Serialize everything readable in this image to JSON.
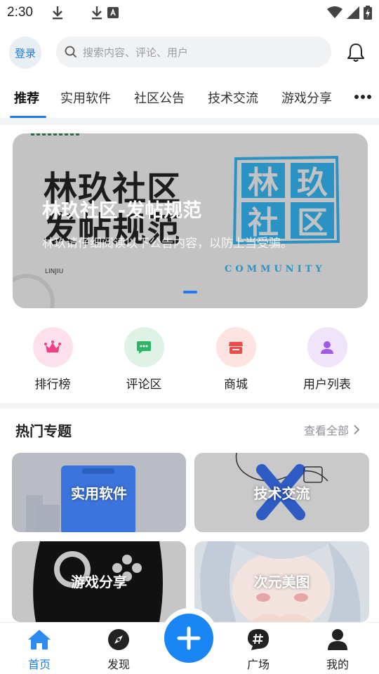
{
  "status_bar": {
    "time": "2:30"
  },
  "header": {
    "login_label": "登录",
    "search_placeholder": "搜索内容、评论、用户"
  },
  "tabs": [
    {
      "label": "推荐",
      "active": true
    },
    {
      "label": "实用软件"
    },
    {
      "label": "社区公告"
    },
    {
      "label": "技术交流"
    },
    {
      "label": "游戏分享"
    }
  ],
  "banner": {
    "title": "林玖社区-发帖规范",
    "subtitle": "林玖请仔细阅读以下公告内容，以防上当受骗。",
    "image_text_big_line1": "林玖社区",
    "image_text_big_line2": "发帖规范",
    "image_logo_text": "林玖社区",
    "image_community_text": "COMMUNITY",
    "image_linjiu_text": "LINJIU",
    "active_index": 0
  },
  "quick_nav": [
    {
      "label": "排行榜",
      "icon": "crown-icon",
      "bg": "#fde0ec",
      "color": "#f23f86"
    },
    {
      "label": "评论区",
      "icon": "chat-icon",
      "bg": "#def2e6",
      "color": "#2fb466"
    },
    {
      "label": "商城",
      "icon": "store-icon",
      "bg": "#fde3e1",
      "color": "#ef4b48"
    },
    {
      "label": "用户列表",
      "icon": "user-icon",
      "bg": "#efe4fa",
      "color": "#a15ae6"
    }
  ],
  "hot_topics": {
    "title": "热门专题",
    "see_all": "查看全部",
    "cards": [
      {
        "label": "实用软件"
      },
      {
        "label": "技术交流"
      },
      {
        "label": "游戏分享"
      },
      {
        "label": "次元美图"
      }
    ]
  },
  "bottom_nav": [
    {
      "label": "首页",
      "icon": "home-icon",
      "active": true
    },
    {
      "label": "发现",
      "icon": "compass-icon"
    },
    {
      "label": "广场",
      "icon": "hashtag-icon"
    },
    {
      "label": "我的",
      "icon": "profile-icon"
    }
  ],
  "colors": {
    "accent": "#1e7be8",
    "fab": "#1a86f5"
  }
}
